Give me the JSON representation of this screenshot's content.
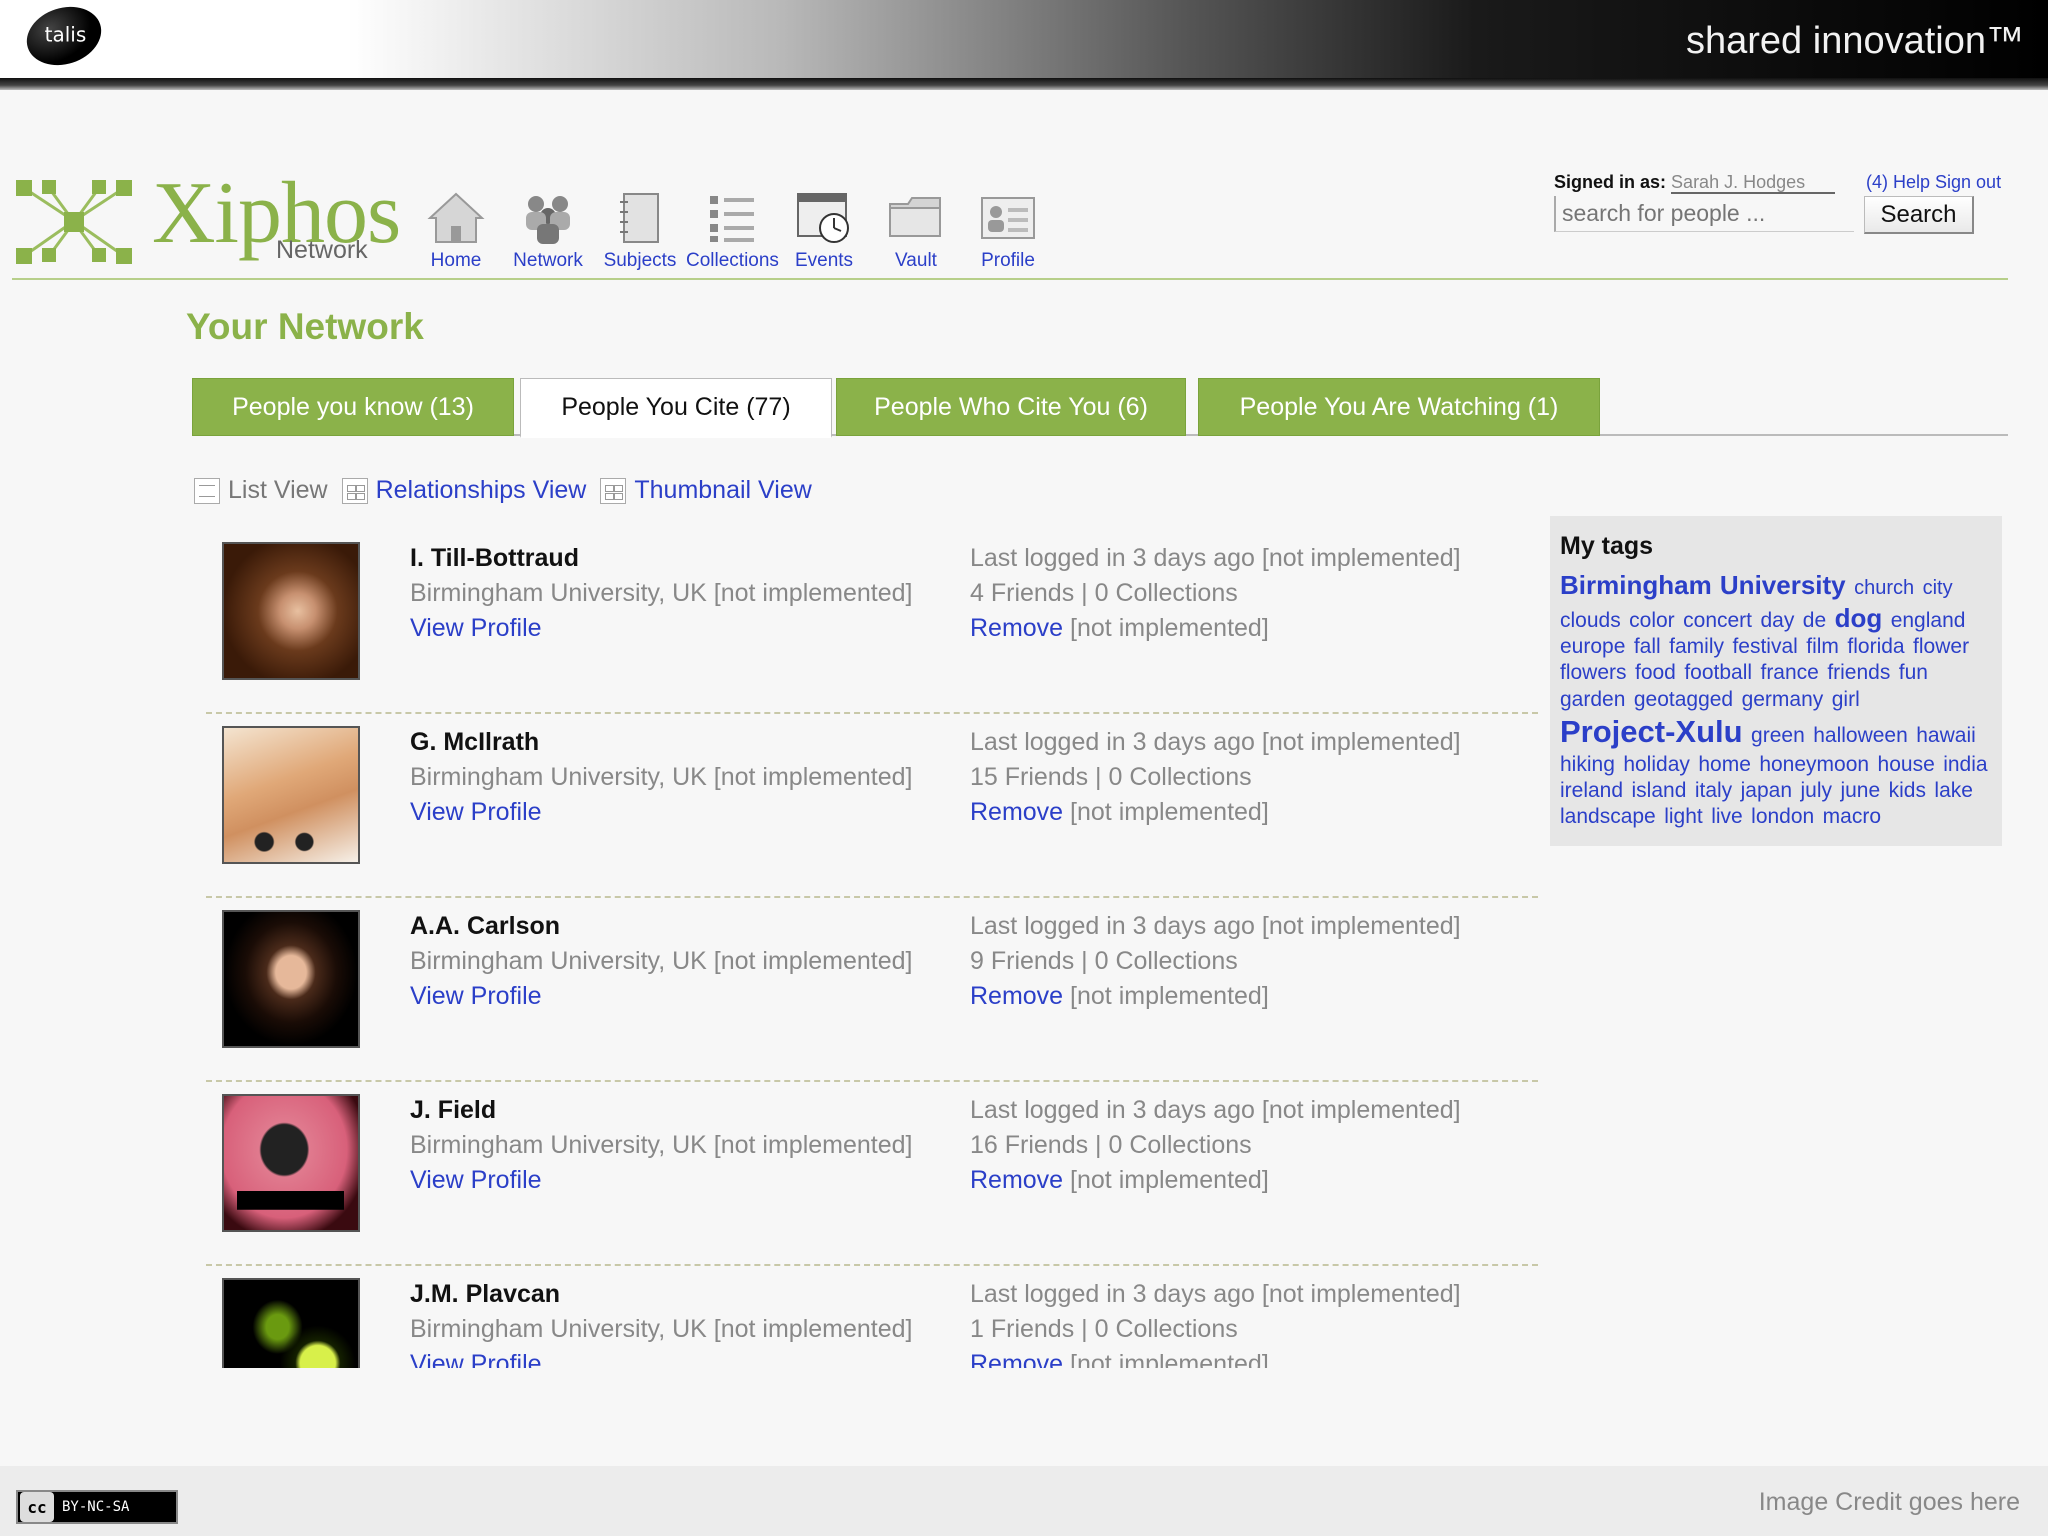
{
  "banner": {
    "logo": "talis",
    "tagline": "shared innovation™"
  },
  "brand": {
    "name": "Xiphos",
    "sub": "Network"
  },
  "nav": [
    {
      "label": "Home",
      "icon": "house-icon"
    },
    {
      "label": "Network",
      "icon": "people-icon"
    },
    {
      "label": "Subjects",
      "icon": "notebook-icon"
    },
    {
      "label": "Collections",
      "icon": "list-icon"
    },
    {
      "label": "Events",
      "icon": "calendar-clock-icon"
    },
    {
      "label": "Vault",
      "icon": "folder-icon"
    },
    {
      "label": "Profile",
      "icon": "profile-card-icon"
    }
  ],
  "account": {
    "signed_label": "Signed in as:",
    "user": "Sarah J. Hodges",
    "links": "(4) Help Sign out",
    "search_placeholder": "search for people ...",
    "search_button": "Search"
  },
  "page_title": "Your Network",
  "tabs": [
    {
      "label": "People you know (13)",
      "active": false
    },
    {
      "label": "People You Cite (77)",
      "active": true
    },
    {
      "label": "People Who Cite You (6)",
      "active": false
    },
    {
      "label": "People You Are Watching (1)",
      "active": false
    }
  ],
  "views": {
    "list": "List View",
    "relationships": "Relationships View",
    "thumbnail": "Thumbnail View"
  },
  "people": [
    {
      "name": "I. Till-Bottraud",
      "institution": "Birmingham University, UK [not implemented]",
      "view": "View Profile",
      "last": "Last logged in 3 days ago [not implemented]",
      "counts": "4 Friends | 0 Collections",
      "remove": "Remove",
      "remove_note": "[not implemented]"
    },
    {
      "name": "G. McIlrath",
      "institution": "Birmingham University, UK [not implemented]",
      "view": "View Profile",
      "last": "Last logged in 3 days ago [not implemented]",
      "counts": "15 Friends | 0 Collections",
      "remove": "Remove",
      "remove_note": "[not implemented]"
    },
    {
      "name": "A.A. Carlson",
      "institution": "Birmingham University, UK [not implemented]",
      "view": "View Profile",
      "last": "Last logged in 3 days ago [not implemented]",
      "counts": "9 Friends | 0 Collections",
      "remove": "Remove",
      "remove_note": "[not implemented]"
    },
    {
      "name": "J. Field",
      "institution": "Birmingham University, UK [not implemented]",
      "view": "View Profile",
      "last": "Last logged in 3 days ago [not implemented]",
      "counts": "16 Friends | 0 Collections",
      "remove": "Remove",
      "remove_note": "[not implemented]"
    },
    {
      "name": "J.M. Plavcan",
      "institution": "Birmingham University, UK [not implemented]",
      "view": "View Profile",
      "last": "Last logged in 3 days ago [not implemented]",
      "counts": "1 Friends | 0 Collections",
      "remove": "Remove",
      "remove_note": "[not implemented]"
    }
  ],
  "tags": {
    "title": "My tags",
    "items": [
      "Birmingham University",
      "church",
      "city",
      "clouds",
      "color",
      "concert",
      "day",
      "de",
      "dog",
      "england",
      "europe",
      "fall",
      "family",
      "festival",
      "film",
      "florida",
      "flower",
      "flowers",
      "food",
      "football",
      "france",
      "friends",
      "fun",
      "garden",
      "geotagged",
      "germany",
      "girl",
      "Project-Xulu",
      "green",
      "halloween",
      "hawaii",
      "hiking",
      "holiday",
      "home",
      "honeymoon",
      "house",
      "india",
      "ireland",
      "island",
      "italy",
      "japan",
      "july",
      "june",
      "kids",
      "lake",
      "landscape",
      "light",
      "live",
      "london",
      "macro"
    ]
  },
  "footer": {
    "license": "BY-NC-SA",
    "license_mark": "cc",
    "credit": "Image Credit goes here"
  }
}
